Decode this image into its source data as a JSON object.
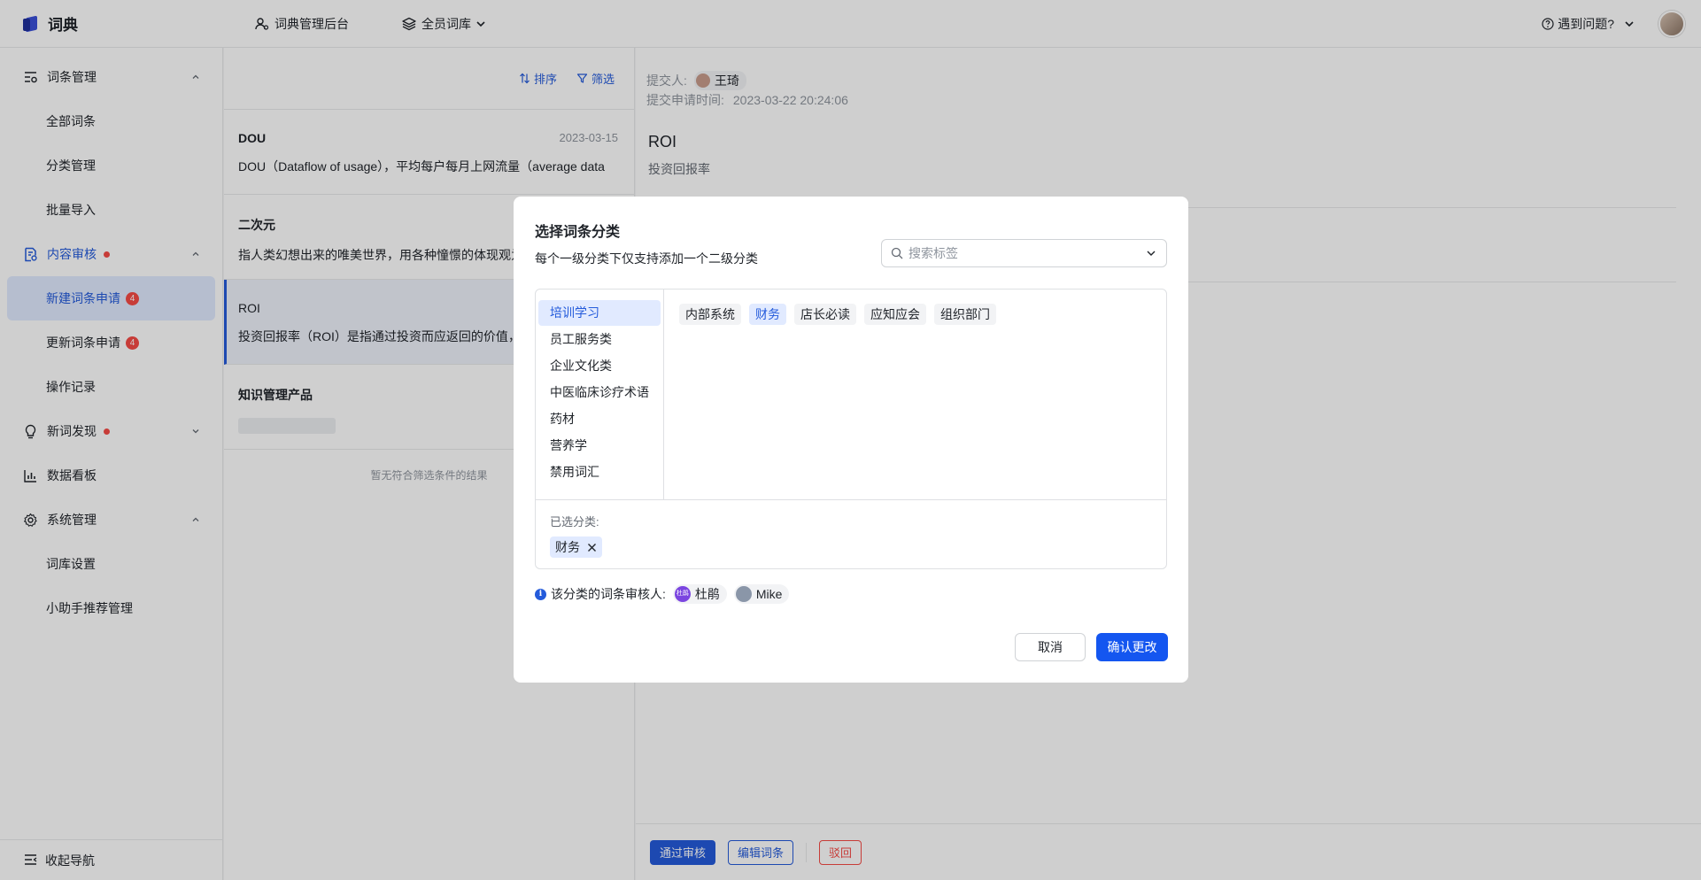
{
  "topbar": {
    "logo_text": "词典",
    "admin_label": "词典管理后台",
    "library_label": "全员词库",
    "help_label": "遇到问题?"
  },
  "sidebar": {
    "groups": [
      {
        "label": "词条管理",
        "children": [
          "全部词条",
          "分类管理",
          "批量导入"
        ]
      },
      {
        "label": "内容审核",
        "children": [
          {
            "label": "新建词条申请",
            "badge": "4"
          },
          {
            "label": "更新词条申请",
            "badge": "4"
          },
          {
            "label": "操作记录"
          }
        ]
      },
      {
        "label": "新词发现"
      },
      {
        "label": "数据看板"
      },
      {
        "label": "系统管理",
        "children": [
          "词库设置",
          "小助手推荐管理"
        ]
      }
    ],
    "collapse_label": "收起导航"
  },
  "list": {
    "sort_label": "排序",
    "filter_label": "筛选",
    "items": [
      {
        "title": "DOU",
        "date": "2023-03-15",
        "desc": "DOU（Dataflow of usage），平均每户每月上网流量（average data"
      },
      {
        "title": "二次元",
        "date": "",
        "desc": "指人类幻想出来的唯美世界，用各种憧憬的体现观为"
      },
      {
        "title": "ROI",
        "date": "",
        "desc": "投资回报率（ROI）是指通过投资而应返回的价值，"
      },
      {
        "title": "知识管理产品",
        "date": "",
        "desc": ""
      }
    ],
    "no_result": "暂无符合筛选条件的结果"
  },
  "detail": {
    "submitter_label": "提交人:",
    "submitter_name": "王琦",
    "time_label": "提交申请时间:",
    "time_value": "2023-03-22 20:24:06",
    "title": "ROI",
    "subtitle": "投资回报率",
    "approve_label": "通过审核",
    "edit_label": "编辑词条",
    "reject_label": "驳回"
  },
  "modal": {
    "title": "选择词条分类",
    "subtitle": "每个一级分类下仅支持添加一个二级分类",
    "search_placeholder": "搜索标签",
    "categories": [
      "培训学习",
      "员工服务类",
      "企业文化类",
      "中医临床诊疗术语",
      "药材",
      "营养学",
      "禁用词汇"
    ],
    "active_category": "培训学习",
    "tags": [
      "内部系统",
      "财务",
      "店长必读",
      "应知应会",
      "组织部门"
    ],
    "selected_tag": "财务",
    "selected_label": "已选分类:",
    "selected_chips": [
      "财务"
    ],
    "reviewers_label": "该分类的词条审核人:",
    "reviewers": [
      {
        "name": "杜鹃",
        "avatar_text": "杜鹃",
        "color": "#7b45e0"
      },
      {
        "name": "Mike",
        "avatar_text": "",
        "color": "#8a96a8"
      }
    ],
    "cancel_label": "取消",
    "confirm_label": "确认更改"
  },
  "colors": {
    "accent": "#245bdb",
    "confirm": "#1456f0",
    "danger": "#f54a45"
  }
}
